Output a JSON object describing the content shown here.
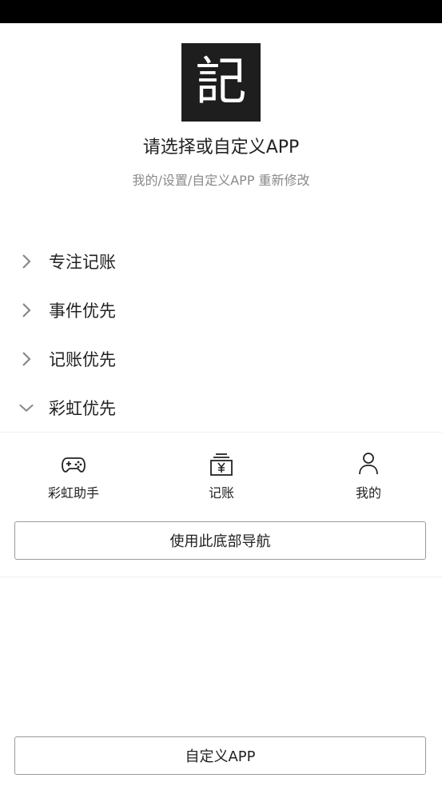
{
  "header": {
    "logo_char": "記",
    "title": "请选择或自定义APP",
    "subtitle": "我的/设置/自定义APP 重新修改"
  },
  "options": [
    {
      "label": "专注记账",
      "expanded": false
    },
    {
      "label": "事件优先",
      "expanded": false
    },
    {
      "label": "记账优先",
      "expanded": false
    },
    {
      "label": "彩虹优先",
      "expanded": true
    }
  ],
  "bottom_nav_preview": {
    "items": [
      {
        "label": "彩虹助手",
        "icon": "gamepad-icon"
      },
      {
        "label": "记账",
        "icon": "ledger-yen-icon"
      },
      {
        "label": "我的",
        "icon": "person-icon"
      }
    ],
    "use_button_label": "使用此底部导航"
  },
  "footer": {
    "custom_button_label": "自定义APP"
  },
  "colors": {
    "status_bar": "#000000",
    "logo_bg": "#1e1e1e",
    "subtitle": "#8a8a8a",
    "button_border": "#9a9a9a"
  }
}
